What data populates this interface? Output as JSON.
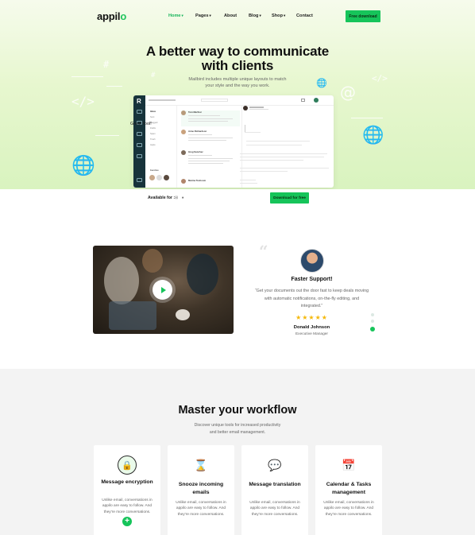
{
  "nav": {
    "logo_main": "appil",
    "logo_accent": "o",
    "items": [
      {
        "label": "Home",
        "has_caret": true,
        "active": true
      },
      {
        "label": "Pages",
        "has_caret": true,
        "active": false
      },
      {
        "label": "About",
        "has_caret": false,
        "active": false
      },
      {
        "label": "Blog",
        "has_caret": true,
        "active": false
      },
      {
        "label": "Shop",
        "has_caret": true,
        "active": false
      },
      {
        "label": "Contact",
        "has_caret": false,
        "active": false
      }
    ],
    "cta_label": "Free download"
  },
  "hero": {
    "title_line1": "A better way to communicate",
    "title_line2": "with clients",
    "subtitle_line1": "Mailbird includes multiple unique layouts to match",
    "subtitle_line2": "your style and the way you work.",
    "app_preview": {
      "reading_title": "Great Tool!",
      "senders": [
        "Tom Merthur",
        "Anne Richardson",
        "Greg Sanchez",
        "Marina Tushoom"
      ]
    },
    "available_label": "Available for :",
    "available_icons": [
      "windows-icon",
      "apple-icon"
    ],
    "cta_label": "Download for free"
  },
  "testimonial": {
    "quote_mark": "“",
    "title": "Faster Support!",
    "text": "“Get your documents out the door fast to keep deals moving with automatic notifications, on-the-fly editing, and integrated.”",
    "stars": "★★★★★",
    "rating": 5,
    "name": "Donald Johnson",
    "role": "Executive Manager",
    "slide_count": 3,
    "active_slide": 3
  },
  "workflow": {
    "title": "Master your workflow",
    "subtitle_line1": "Discover unique tools for increased productivity",
    "subtitle_line2": "and better email management.",
    "cards": [
      {
        "title": "Message encryption",
        "icon": "lock-icon",
        "desc": "Unlike email, conversations in appilo are easy to follow. And they're more conversations.",
        "has_add": true
      },
      {
        "title": "Snooze incoming emails",
        "icon": "hourglass-icon",
        "desc": "Unlike email, conversations in appilo are easy to follow. And they're more conversations.",
        "has_add": false
      },
      {
        "title": "Message translation",
        "icon": "translate-icon",
        "desc": "Unlike email, conversations in appilo are easy to follow. And they're more conversations.",
        "has_add": false
      },
      {
        "title": "Calendar & Tasks management",
        "icon": "calendar-icon",
        "desc": "Unlike email, conversations in appilo are easy to follow. And they're more conversations.",
        "has_add": false
      }
    ]
  },
  "colors": {
    "accent": "#16c45a",
    "star": "#f5b80a",
    "sidebar": "#17333b"
  }
}
